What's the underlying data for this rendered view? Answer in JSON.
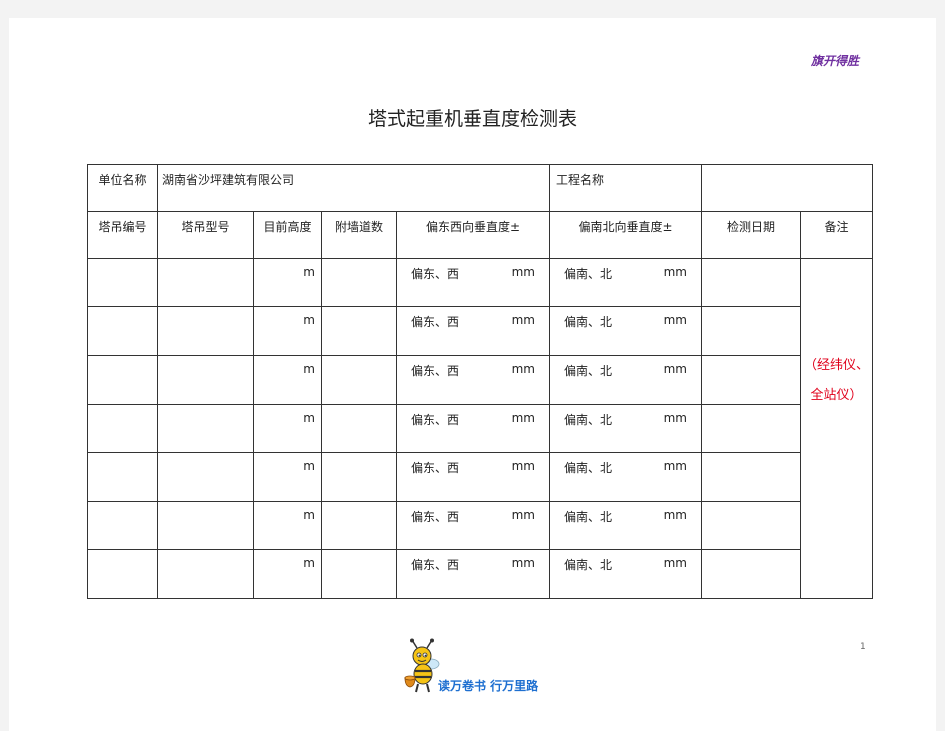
{
  "header_tag": "旗开得胜",
  "title": "塔式起重机垂直度检测表",
  "info_row": {
    "unit_label": "单位名称",
    "unit_value": "湖南省沙坪建筑有限公司",
    "project_label": "工程名称",
    "project_value": ""
  },
  "columns": [
    "塔吊编号",
    "塔吊型号",
    "目前高度",
    "附墙道数",
    "偏东西向垂直度±",
    "偏南北向垂直度±",
    "检测日期",
    "备注"
  ],
  "rows": [
    {
      "height_unit": "m",
      "ew_label": "偏东、西",
      "ew_unit": "mm",
      "ns_label": "偏南、北",
      "ns_unit": "mm"
    },
    {
      "height_unit": "m",
      "ew_label": "偏东、西",
      "ew_unit": "mm",
      "ns_label": "偏南、北",
      "ns_unit": "mm"
    },
    {
      "height_unit": "m",
      "ew_label": "偏东、西",
      "ew_unit": "mm",
      "ns_label": "偏南、北",
      "ns_unit": "mm"
    },
    {
      "height_unit": "m",
      "ew_label": "偏东、西",
      "ew_unit": "mm",
      "ns_label": "偏南、北",
      "ns_unit": "mm"
    },
    {
      "height_unit": "m",
      "ew_label": "偏东、西",
      "ew_unit": "mm",
      "ns_label": "偏南、北",
      "ns_unit": "mm"
    },
    {
      "height_unit": "m",
      "ew_label": "偏东、西",
      "ew_unit": "mm",
      "ns_label": "偏南、北",
      "ns_unit": "mm"
    },
    {
      "height_unit": "m",
      "ew_label": "偏东、西",
      "ew_unit": "mm",
      "ns_label": "偏南、北",
      "ns_unit": "mm"
    }
  ],
  "remark": {
    "line1": "（经纬仪、",
    "line2": "全站仪）"
  },
  "page_number": "1",
  "footer_slogan": "读万卷书  行万里路",
  "colors": {
    "header_tag": "#7030a0",
    "remark": "#e0001b",
    "slogan": "#1e6fd0"
  }
}
